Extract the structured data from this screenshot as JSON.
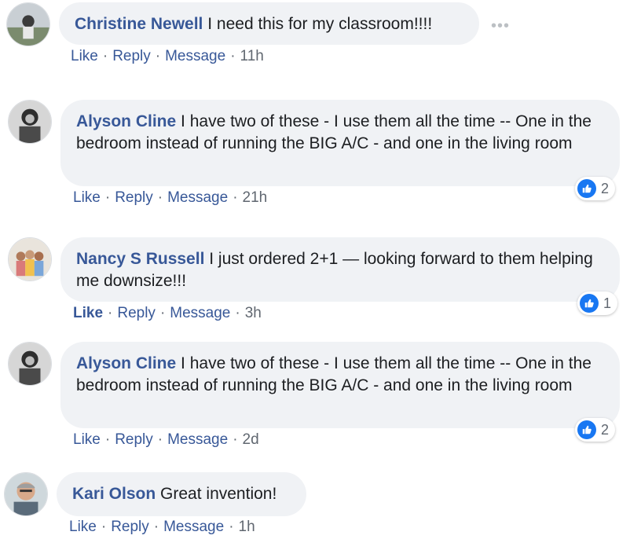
{
  "comments": [
    {
      "author": "Christine Newell",
      "text": "I need this for my classroom!!!!",
      "actions": {
        "like": "Like",
        "reply": "Reply",
        "message": "Message"
      },
      "time": "11h",
      "more_icon": "ellipsis-icon"
    },
    {
      "author": "Alyson Cline",
      "text": "I have two of these - I use them all the time -- One in the bedroom instead of running the BIG A/C - and one in the living room",
      "actions": {
        "like": "Like",
        "reply": "Reply",
        "message": "Message"
      },
      "time": "21h",
      "reactions": {
        "icon": "like-icon",
        "count": "2"
      }
    },
    {
      "author": "Nancy S Russell",
      "text": "I just ordered 2+1 — looking forward to them helping me downsize!!!",
      "actions": {
        "like": "Like",
        "reply": "Reply",
        "message": "Message"
      },
      "time": "3h",
      "reactions": {
        "icon": "like-icon",
        "count": "1"
      }
    },
    {
      "author": "Alyson Cline",
      "text": "I have two of these - I use them all the time -- One in the bedroom instead of running the BIG A/C - and one in the living room",
      "actions": {
        "like": "Like",
        "reply": "Reply",
        "message": "Message"
      },
      "time": "2d",
      "reactions": {
        "icon": "like-icon",
        "count": "2"
      }
    },
    {
      "author": "Kari Olson",
      "text": "Great invention!",
      "actions": {
        "like": "Like",
        "reply": "Reply",
        "message": "Message"
      },
      "time": "1h"
    }
  ],
  "separator": "·",
  "more_text": "•••",
  "colors": {
    "link": "#385898",
    "bubble": "#f0f2f5",
    "like_blue": "#1877f2"
  }
}
